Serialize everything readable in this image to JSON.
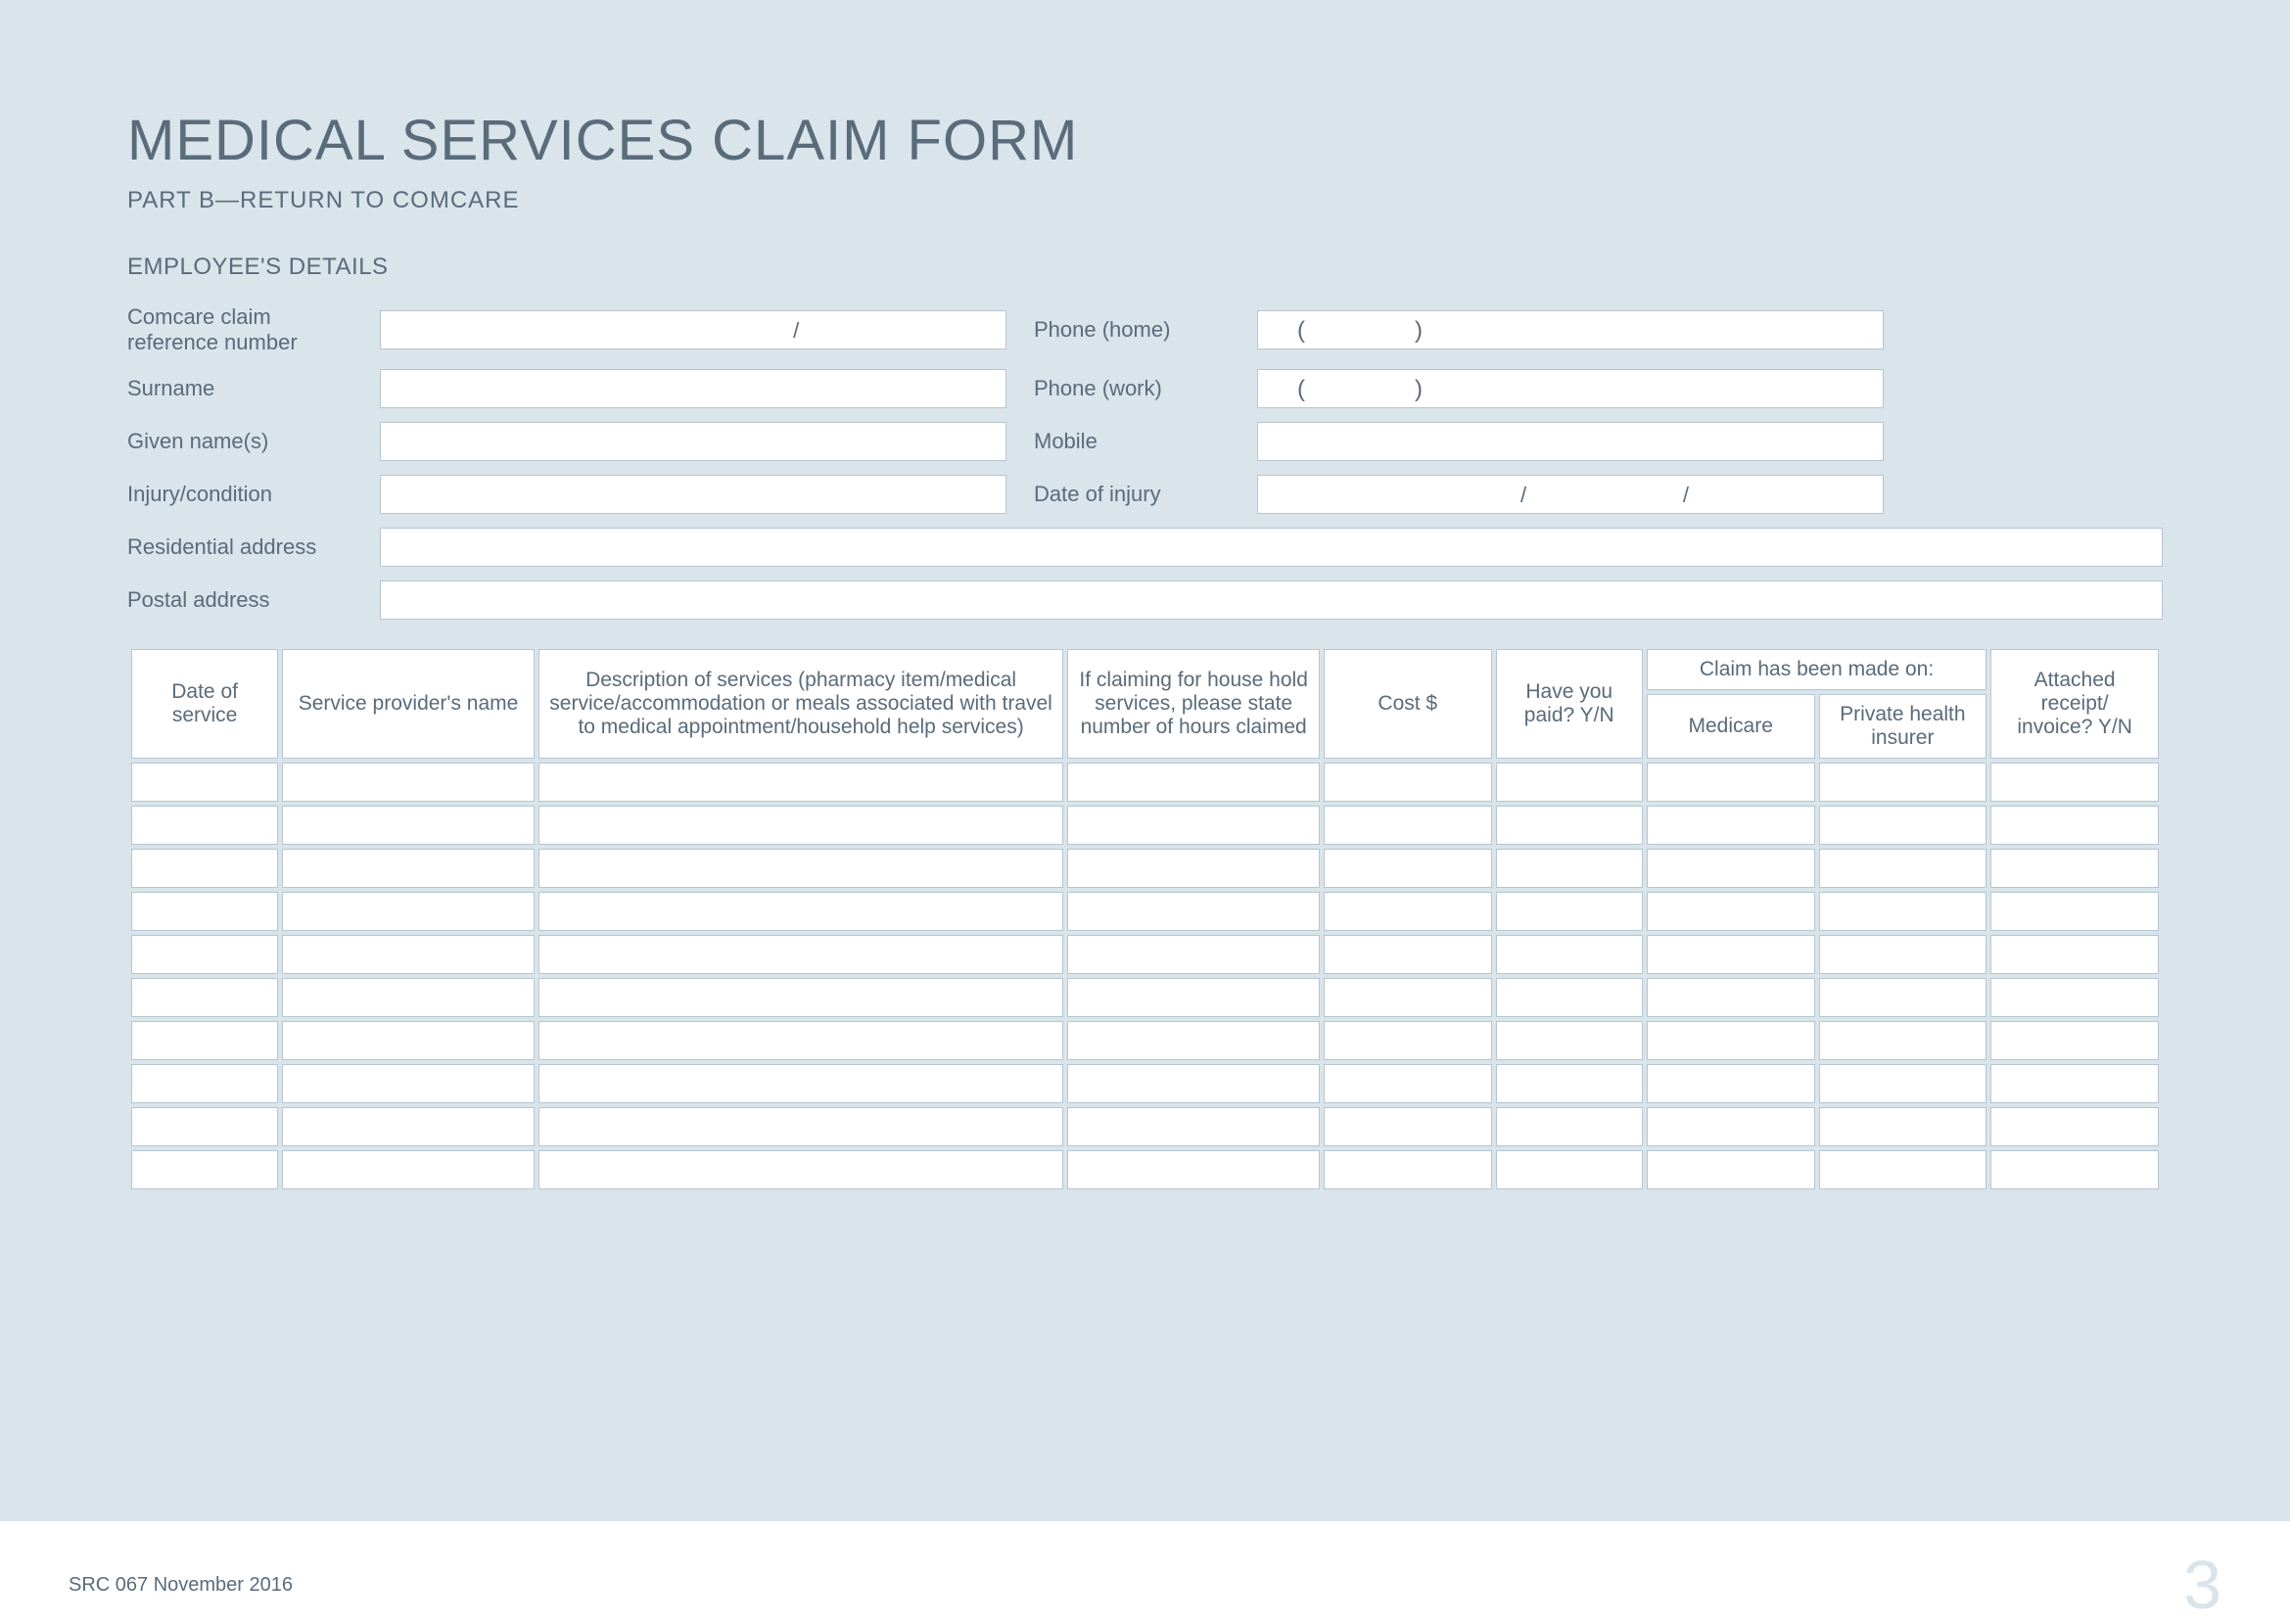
{
  "title": "MEDICAL SERVICES CLAIM FORM",
  "subtitle": "PART B—RETURN TO COMCARE",
  "section": "EMPLOYEE'S DETAILS",
  "labels": {
    "ref": "Comcare claim reference number",
    "surname": "Surname",
    "given": "Given name(s)",
    "injury": "Injury/condition",
    "residential": "Residential address",
    "postal": "Postal address",
    "phone_home": "Phone (home)",
    "phone_work": "Phone (work)",
    "mobile": "Mobile",
    "doi": "Date of injury"
  },
  "table": {
    "h_date": "Date of service",
    "h_prov": "Service provider's name",
    "h_desc": "Description of services (pharmacy item/medical service/accommodation or meals associated with travel to medical appointment/household help services)",
    "h_hours": "If claiming for house hold services, please state number of hours claimed",
    "h_cost": "Cost $",
    "h_paid": "Have you paid? Y/N",
    "h_claim": "Claim has been made on:",
    "h_med": "Medicare",
    "h_ins": "Private health insurer",
    "h_rec": "Attached receipt/ invoice? Y/N"
  },
  "footer": {
    "left": "SRC 067 November 2016",
    "page": "3"
  },
  "glyphs": {
    "slash": "/",
    "lparen": "(",
    "rparen": ")"
  }
}
